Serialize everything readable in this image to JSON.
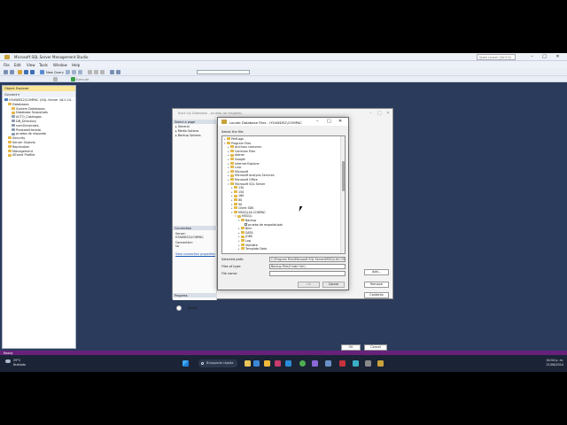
{
  "window_title": "Microsoft SQL Server Management Studio",
  "quick_launch": "Quick Launch (Ctrl+Q)",
  "menu": [
    "File",
    "Edit",
    "View",
    "Tools",
    "Window",
    "Help"
  ],
  "toolbar": {
    "new_query": "New Query",
    "execute": "Execute"
  },
  "object_explorer": {
    "title": "Object Explorer",
    "connect": "Connect ▾",
    "items": [
      {
        "level": 0,
        "label": "H34WDS2\\COMPAC (SQL Server 16.0.10..",
        "kind": "server"
      },
      {
        "level": 1,
        "label": "Databases",
        "kind": "folder"
      },
      {
        "level": 2,
        "label": "System Databases",
        "kind": "folder"
      },
      {
        "level": 2,
        "label": "Database Snapshots",
        "kind": "folder"
      },
      {
        "level": 2,
        "label": "ACTO_Catalogos",
        "kind": "db"
      },
      {
        "level": 2,
        "label": "DB_Directory",
        "kind": "db"
      },
      {
        "level": 2,
        "label": "nomGenerales",
        "kind": "db"
      },
      {
        "level": 2,
        "label": "PrestamiHmada",
        "kind": "db"
      },
      {
        "level": 2,
        "label": "prueba de respaldo",
        "kind": "db"
      },
      {
        "level": 1,
        "label": "Security",
        "kind": "folder"
      },
      {
        "level": 1,
        "label": "Server Objects",
        "kind": "folder"
      },
      {
        "level": 1,
        "label": "Replication",
        "kind": "folder"
      },
      {
        "level": 1,
        "label": "Management",
        "kind": "folder"
      },
      {
        "level": 1,
        "label": "XEvent Profiler",
        "kind": "folder"
      }
    ]
  },
  "backup_dialog": {
    "title": "Back Up Database - prueba de respaldo",
    "select_page": "Select a page",
    "pages": [
      "General",
      "Media Options",
      "Backup Options"
    ],
    "connection_header": "Connection",
    "server_label": "Server:",
    "server_value": "H34WDS2\\COMPAC",
    "connection_label": "Connection:",
    "connection_value": "sa",
    "view_conn": "View connection properties",
    "progress_header": "Progress",
    "progress_status": "Ready",
    "add": "Add...",
    "remove": "Remove",
    "contents": "Contents",
    "ok": "OK",
    "cancel": "Cancel"
  },
  "locate_dialog": {
    "title": "Locate Database Files - H34WDS2\\COMPAC",
    "select_file": "Select the file:",
    "tree": [
      {
        "level": 1,
        "label": "PerfLogs",
        "kind": "folder",
        "toggle": "+"
      },
      {
        "level": 1,
        "label": "Program Files",
        "kind": "folder",
        "toggle": "-"
      },
      {
        "level": 2,
        "label": "Archivos comunes",
        "kind": "folder",
        "toggle": "+"
      },
      {
        "level": 2,
        "label": "Common Files",
        "kind": "folder",
        "toggle": "+"
      },
      {
        "level": 2,
        "label": "dotnet",
        "kind": "folder",
        "toggle": "+"
      },
      {
        "level": 2,
        "label": "Google",
        "kind": "folder",
        "toggle": "+"
      },
      {
        "level": 2,
        "label": "Internet Explorer",
        "kind": "folder",
        "toggle": "+"
      },
      {
        "level": 2,
        "label": "Lnrp",
        "kind": "folder",
        "toggle": "+"
      },
      {
        "level": 2,
        "label": "Microsoft",
        "kind": "folder",
        "toggle": "+"
      },
      {
        "level": 2,
        "label": "Microsoft Analysis Services",
        "kind": "folder",
        "toggle": "+"
      },
      {
        "level": 2,
        "label": "Microsoft Office",
        "kind": "folder",
        "toggle": "+"
      },
      {
        "level": 2,
        "label": "Microsoft SQL Server",
        "kind": "folder",
        "toggle": "-"
      },
      {
        "level": 3,
        "label": "130",
        "kind": "folder",
        "toggle": "+"
      },
      {
        "level": 3,
        "label": "150",
        "kind": "folder",
        "toggle": "+"
      },
      {
        "level": 3,
        "label": "160",
        "kind": "folder",
        "toggle": "+"
      },
      {
        "level": 3,
        "label": "80",
        "kind": "folder",
        "toggle": "+"
      },
      {
        "level": 3,
        "label": "90",
        "kind": "folder",
        "toggle": "+"
      },
      {
        "level": 3,
        "label": "Client SDK",
        "kind": "folder",
        "toggle": "+"
      },
      {
        "level": 3,
        "label": "MSSQL16.COMPAC",
        "kind": "folder",
        "toggle": "-"
      },
      {
        "level": 4,
        "label": "MSSQL",
        "kind": "folder",
        "toggle": "-"
      },
      {
        "level": 5,
        "label": "Backup",
        "kind": "folder",
        "toggle": "-"
      },
      {
        "level": 6,
        "label": "prueba de respaldo.bak",
        "kind": "file",
        "toggle": ""
      },
      {
        "level": 5,
        "label": "Binn",
        "kind": "folder",
        "toggle": "+"
      },
      {
        "level": 5,
        "label": "DATA",
        "kind": "folder",
        "toggle": "+"
      },
      {
        "level": 5,
        "label": "JOBS",
        "kind": "folder",
        "toggle": "+"
      },
      {
        "level": 5,
        "label": "Log",
        "kind": "folder",
        "toggle": "+"
      },
      {
        "level": 5,
        "label": "repldata",
        "kind": "folder",
        "toggle": "+"
      },
      {
        "level": 5,
        "label": "Template Data",
        "kind": "folder",
        "toggle": "+"
      }
    ],
    "selected_path_label": "Selected path:",
    "selected_path_value": "C:\\Program Files\\Microsoft SQL Server\\MSSQL16.COMPAC\\MSSQL\\Backup",
    "files_of_type_label": "Files of type:",
    "files_of_type_value": "Backup Files(*.bak;*.tm)",
    "file_name_label": "File name:",
    "file_name_value": "",
    "ok": "OK",
    "cancel": "Cancel"
  },
  "status_bar": "Ready",
  "taskbar": {
    "weather_temp": "29°C",
    "weather_desc": "Nublado",
    "search": "Búsqueda rápida",
    "time": "04:54 p. m.",
    "date": "21/08/2024"
  }
}
